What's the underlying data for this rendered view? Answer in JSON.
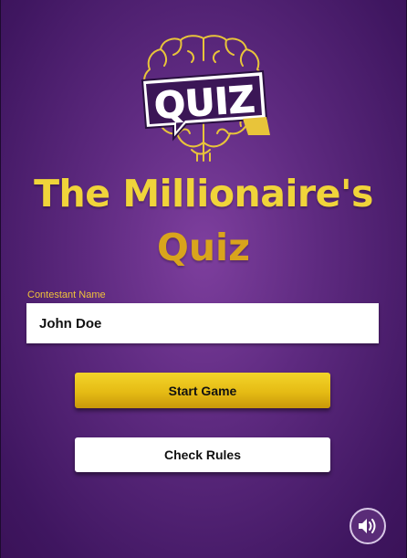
{
  "logo": {
    "text": "QUIZ",
    "icon": "brain-quiz-logo"
  },
  "title": {
    "line1": "The Millionaire's",
    "line2": "Quiz"
  },
  "contestant": {
    "label": "Contestant Name",
    "value": "John Doe"
  },
  "buttons": {
    "start_label": "Start Game",
    "rules_label": "Check Rules"
  },
  "sound": {
    "icon": "speaker-on-icon"
  },
  "colors": {
    "background": "#5e2a80",
    "title_primary": "#f0d43a",
    "title_secondary": "#d9a41c",
    "start_button": "#e5bb14",
    "label": "#f0c23a"
  }
}
